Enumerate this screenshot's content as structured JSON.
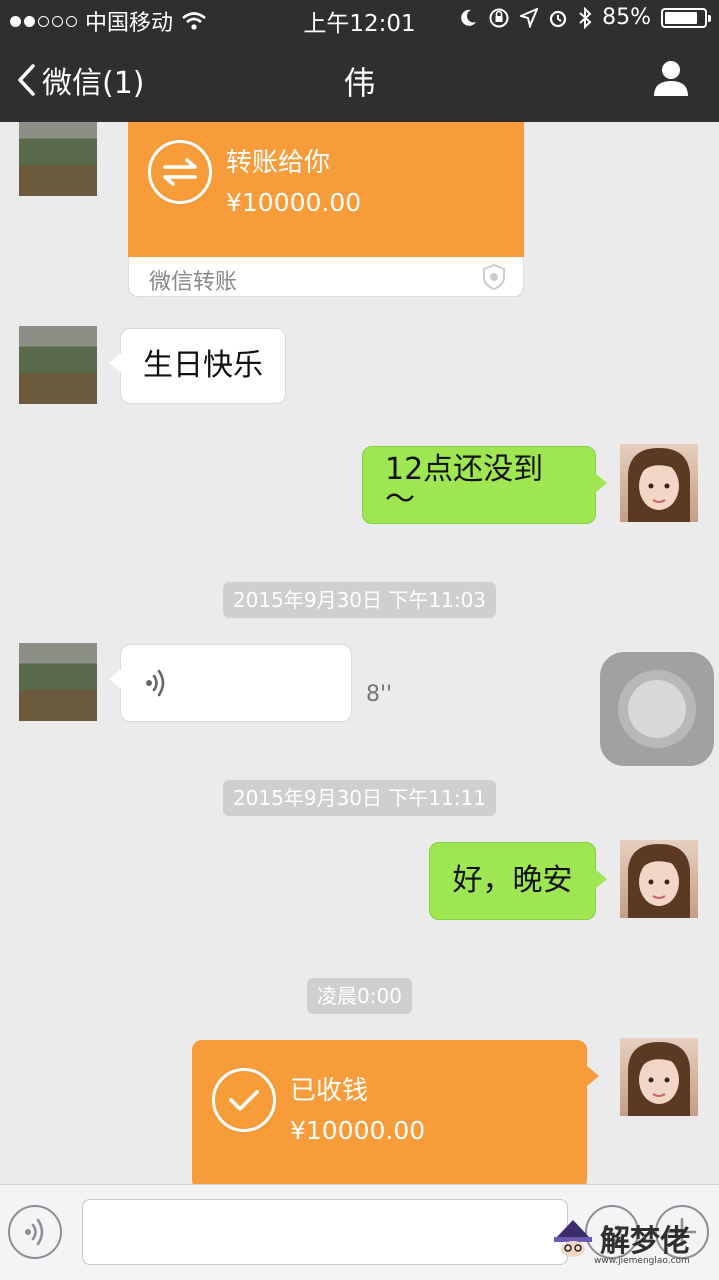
{
  "status_bar": {
    "carrier": "中国移动",
    "time": "上午12:01",
    "battery": "85%",
    "battery_level": 0.85,
    "signal_bars_filled": 2,
    "signal_bars_total": 5
  },
  "nav": {
    "back_label": "微信(1)",
    "title": "伟"
  },
  "messages": {
    "m1": {
      "sender": "contact",
      "type": "transfer",
      "title": "转账给你",
      "amount": "¥10000.00",
      "footer": "微信转账"
    },
    "m2": {
      "sender": "contact",
      "type": "text",
      "text": "生日快乐"
    },
    "m3": {
      "sender": "me",
      "type": "text",
      "text": "12点还没到～"
    },
    "ts1": "2015年9月30日 下午11:03",
    "m4": {
      "sender": "contact",
      "type": "voice",
      "duration": "8''"
    },
    "ts2": "2015年9月30日 下午11:11",
    "m5": {
      "sender": "me",
      "type": "text",
      "text": "好，晚安"
    },
    "ts3": "凌晨0:00",
    "m6": {
      "sender": "me",
      "type": "transfer",
      "title": "已收钱",
      "amount": "¥10000.00"
    }
  },
  "watermark": {
    "text": "解梦佬",
    "url": "www.jiemenglao.com"
  },
  "colors": {
    "header_bg": "#2f2f31",
    "chat_bg": "#ebebeb",
    "transfer_orange": "#f79c3a",
    "bubble_green": "#9ee652",
    "timestamp_bg": "#cfcfcf"
  }
}
